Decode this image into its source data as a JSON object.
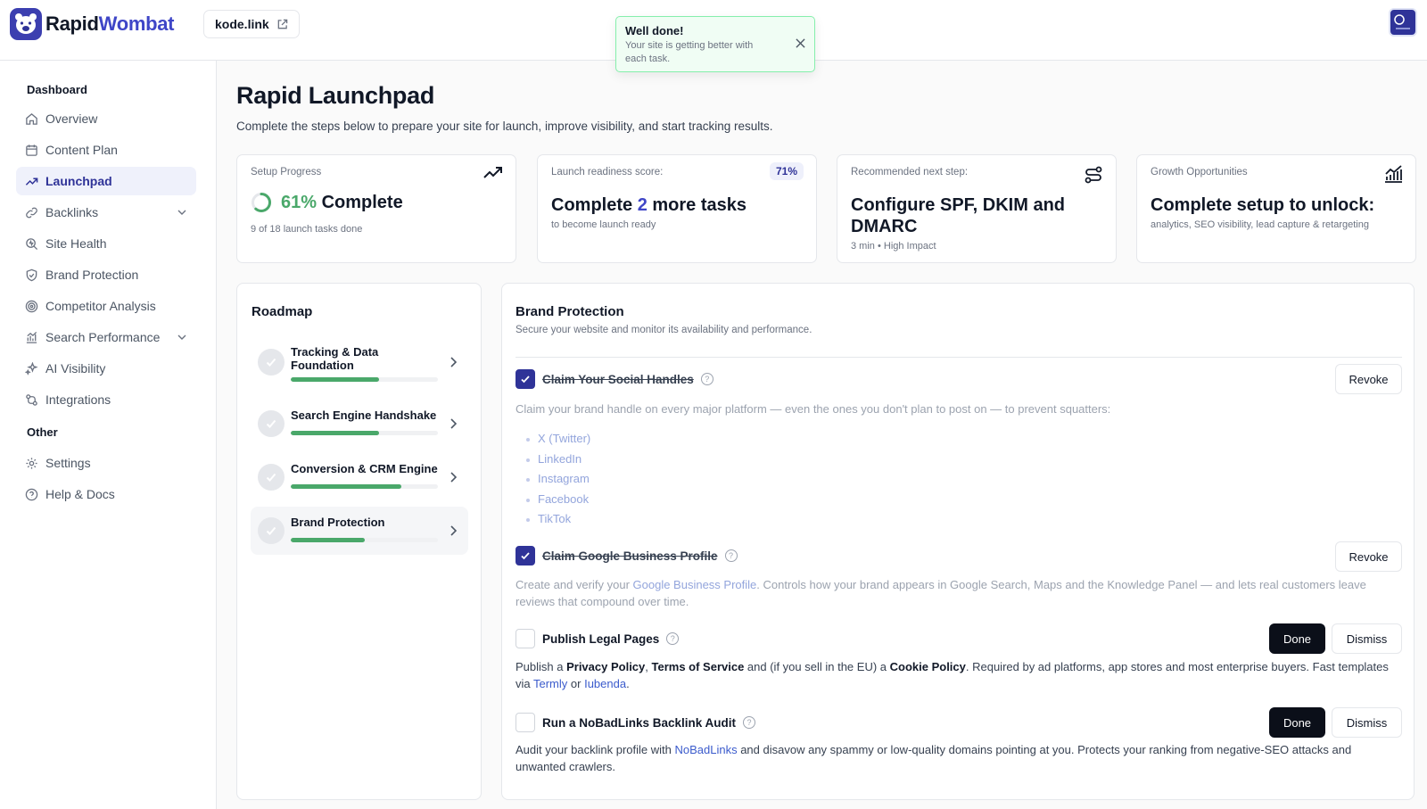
{
  "brand": {
    "name_part1": "Rapid",
    "name_part2": "Wombat"
  },
  "site": {
    "domain": "kode.link"
  },
  "toast": {
    "title": "Well done!",
    "message": "Your site is getting better with each task."
  },
  "sidebar": {
    "section_dashboard": "Dashboard",
    "items": [
      {
        "label": "Overview",
        "icon": "home-icon"
      },
      {
        "label": "Content Plan",
        "icon": "calendar-icon"
      },
      {
        "label": "Launchpad",
        "icon": "trending-up-icon",
        "active": true
      },
      {
        "label": "Backlinks",
        "icon": "link-icon",
        "expandable": true
      },
      {
        "label": "Site Health",
        "icon": "search-health-icon"
      },
      {
        "label": "Brand Protection",
        "icon": "shield-icon"
      },
      {
        "label": "Competitor Analysis",
        "icon": "target-icon"
      },
      {
        "label": "Search Performance",
        "icon": "bar-chart-icon",
        "expandable": true
      },
      {
        "label": "AI Visibility",
        "icon": "sparkles-icon"
      },
      {
        "label": "Integrations",
        "icon": "integrations-icon"
      }
    ],
    "section_other": "Other",
    "other_items": [
      {
        "label": "Settings",
        "icon": "gear-icon"
      },
      {
        "label": "Help & Docs",
        "icon": "help-circle-icon"
      }
    ]
  },
  "page": {
    "title": "Rapid Launchpad",
    "subtitle": "Complete the steps below to prepare your site for launch, improve visibility, and start tracking results."
  },
  "cards": {
    "setup": {
      "label": "Setup Progress",
      "percent": "61%",
      "percent_value": 61,
      "suffix": "Complete",
      "detail": "9 of 18 launch tasks done"
    },
    "readiness": {
      "label": "Launch readiness score:",
      "badge": "71%",
      "prefix": "Complete",
      "count": "2",
      "suffix": "more tasks",
      "detail": "to become launch ready"
    },
    "next": {
      "label": "Recommended next step:",
      "title": "Configure SPF, DKIM and DMARC",
      "time": "3 min",
      "impact": "High Impact"
    },
    "growth": {
      "label": "Growth Opportunities",
      "title": "Complete setup to unlock:",
      "detail": "analytics, SEO visibility, lead capture & retargeting"
    }
  },
  "roadmap": {
    "title": "Roadmap",
    "items": [
      {
        "label": "Tracking & Data Foundation",
        "progress": 0.6
      },
      {
        "label": "Search Engine Handshake",
        "progress": 0.6
      },
      {
        "label": "Conversion & CRM Engine",
        "progress": 0.75
      },
      {
        "label": "Brand Protection",
        "progress": 0.5,
        "active": true
      }
    ]
  },
  "panel": {
    "title": "Brand Protection",
    "subtitle": "Secure your website and monitor its availability and performance.",
    "tasks": {
      "social": {
        "title": "Claim Your Social Handles",
        "done": true,
        "desc": "Claim your brand handle on every major platform — even the ones you don't plan to post on — to prevent squatters:",
        "platforms": [
          "X (Twitter)",
          "LinkedIn",
          "Instagram",
          "Facebook",
          "TikTok"
        ],
        "action": "Revoke"
      },
      "gbp": {
        "title": "Claim Google Business Profile",
        "done": true,
        "desc_pre": "Create and verify your ",
        "desc_link": "Google Business Profile",
        "desc_post": ". Controls how your brand appears in Google Search, Maps and the Knowledge Panel — and lets real customers leave reviews that compound over time.",
        "action": "Revoke"
      },
      "legal": {
        "title": "Publish Legal Pages",
        "done": false,
        "desc_1": "Publish a ",
        "b1": "Privacy Policy",
        "sep": ", ",
        "b2": "Terms of Service",
        "desc_2": " and (if you sell in the EU) a ",
        "b3": "Cookie Policy",
        "desc_3": ". Required by ad platforms, app stores and most enterprise buyers. Fast templates via ",
        "link1": "Termly",
        "or": " or ",
        "link2": "Iubenda",
        "end": ".",
        "done_label": "Done",
        "dismiss_label": "Dismiss"
      },
      "audit": {
        "title": "Run a NoBadLinks Backlink Audit",
        "done": false,
        "desc_pre": "Audit your backlink profile with ",
        "desc_link": "NoBadLinks",
        "desc_post": " and disavow any spammy or low-quality domains pointing at you. Protects your ranking from negative-SEO attacks and unwanted crawlers.",
        "done_label": "Done",
        "dismiss_label": "Dismiss"
      }
    }
  },
  "colors": {
    "accent": "#3f46c7",
    "brand": "#2f3398",
    "success": "#4aa86a"
  }
}
